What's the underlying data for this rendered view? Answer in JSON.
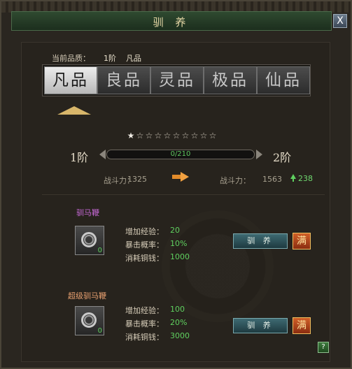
{
  "window": {
    "title": "驯 养",
    "close_label": "X",
    "help_label": "?"
  },
  "quality": {
    "label": "当前品质：",
    "level": "1阶",
    "name": "凡品"
  },
  "tabs": [
    {
      "label": "凡品",
      "selected": true
    },
    {
      "label": "良品",
      "selected": false
    },
    {
      "label": "灵品",
      "selected": false
    },
    {
      "label": "极品",
      "selected": false
    },
    {
      "label": "仙品",
      "selected": false
    }
  ],
  "stars": {
    "filled": 1,
    "total": 10
  },
  "progress": {
    "current_level": "1阶",
    "next_level": "2阶",
    "text": "0/210",
    "fraction": 0
  },
  "power": {
    "label_current": "战斗力：",
    "current": "1325",
    "label_next": "战斗力：",
    "next": "1563",
    "increase": "238"
  },
  "items": [
    {
      "name": "驯马鞭",
      "name_color": "#c86ad8",
      "count": "0",
      "stats": [
        {
          "label": "增加经验：",
          "value": "20"
        },
        {
          "label": "暴击概率：",
          "value": "10%"
        },
        {
          "label": "消耗铜钱：",
          "value": "1000"
        }
      ],
      "button": "驯 养",
      "max": "满"
    },
    {
      "name": "超级驯马鞭",
      "name_color": "#e8a070",
      "count": "0",
      "stats": [
        {
          "label": "增加经验：",
          "value": "100"
        },
        {
          "label": "暴击概率：",
          "value": "20%"
        },
        {
          "label": "消耗铜钱：",
          "value": "3000"
        }
      ],
      "button": "驯 养",
      "max": "满"
    }
  ]
}
